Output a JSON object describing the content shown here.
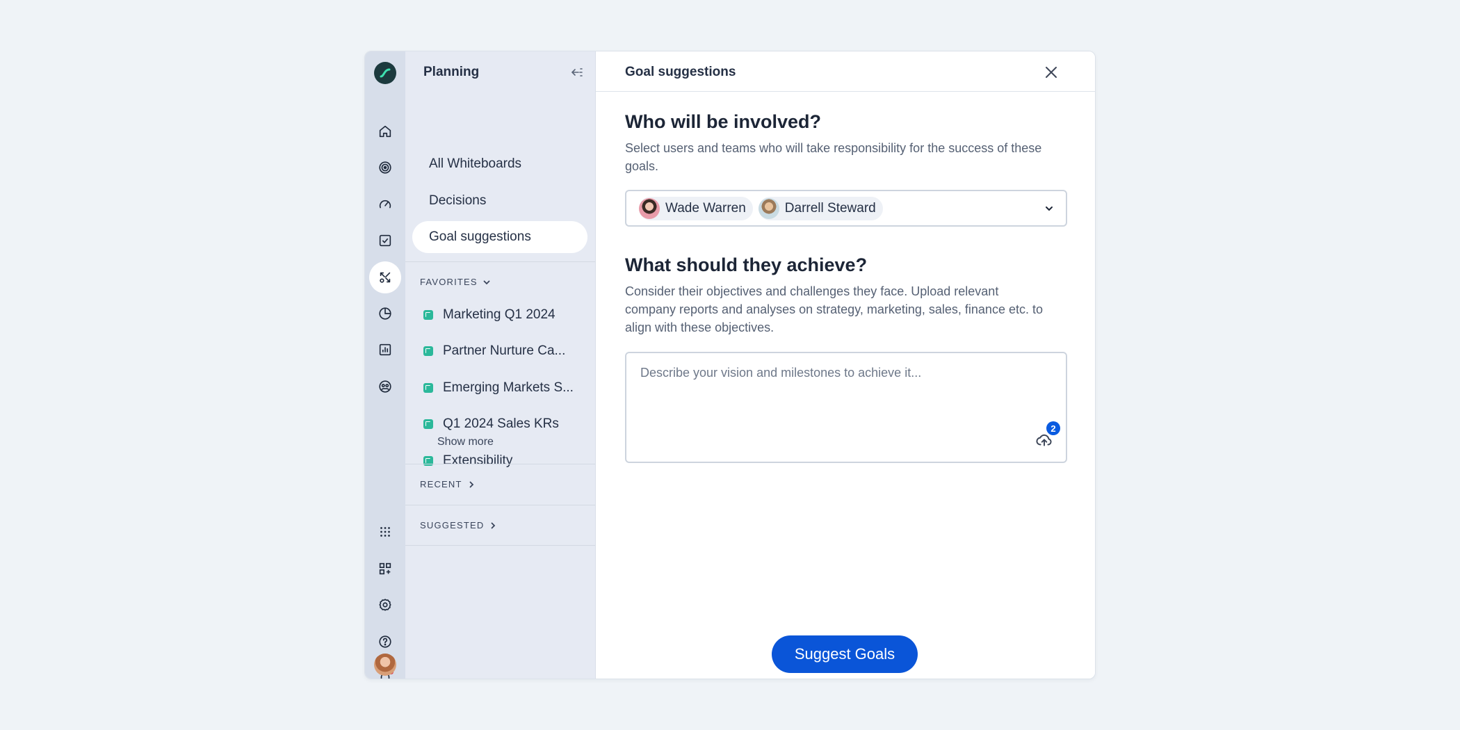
{
  "sidebar": {
    "title": "Planning",
    "nav": [
      {
        "label": "All Whiteboards"
      },
      {
        "label": "Decisions"
      },
      {
        "label": "Goal suggestions"
      }
    ],
    "favorites": {
      "label": "FAVORITES",
      "items": [
        {
          "label": "Marketing Q1 2024"
        },
        {
          "label": "Partner Nurture Ca..."
        },
        {
          "label": "Emerging Markets S..."
        },
        {
          "label": "Q1 2024 Sales KRs"
        },
        {
          "label": "Extensibility"
        }
      ],
      "show_more": "Show more"
    },
    "recent_label": "RECENT",
    "suggested_label": "SUGGESTED"
  },
  "rail": {
    "icons": [
      "home-icon",
      "goals-target-icon",
      "gauge-icon",
      "checkbox-icon",
      "whiteboard-tools-icon",
      "pie-chart-icon",
      "bar-chart-icon",
      "people-icon",
      "apps-grid-icon",
      "add-widget-icon",
      "settings-gear-icon",
      "help-icon",
      "bell-icon",
      "user-avatar"
    ],
    "active": "whiteboard-tools-icon",
    "notification_dot": true
  },
  "main": {
    "title": "Goal suggestions",
    "involved": {
      "heading": "Who will be involved?",
      "description": "Select users and teams who will take responsibility for the success of these goals.",
      "people": [
        {
          "name": "Wade Warren"
        },
        {
          "name": "Darrell Steward"
        }
      ]
    },
    "achieve": {
      "heading": "What should they achieve?",
      "description": "Consider their objectives and challenges they face. Upload relevant company reports and analyses on strategy, marketing, sales, finance etc. to align with these objectives.",
      "placeholder": "Describe your vision and milestones to achieve it...",
      "attachment_count": "2"
    },
    "submit_label": "Suggest Goals"
  },
  "colors": {
    "accent": "#0a55d8",
    "rail_bg": "#d7deea",
    "panel_bg": "#e6eaf3",
    "favorite_icon": "#2bb89a",
    "notification": "#d9304a"
  }
}
